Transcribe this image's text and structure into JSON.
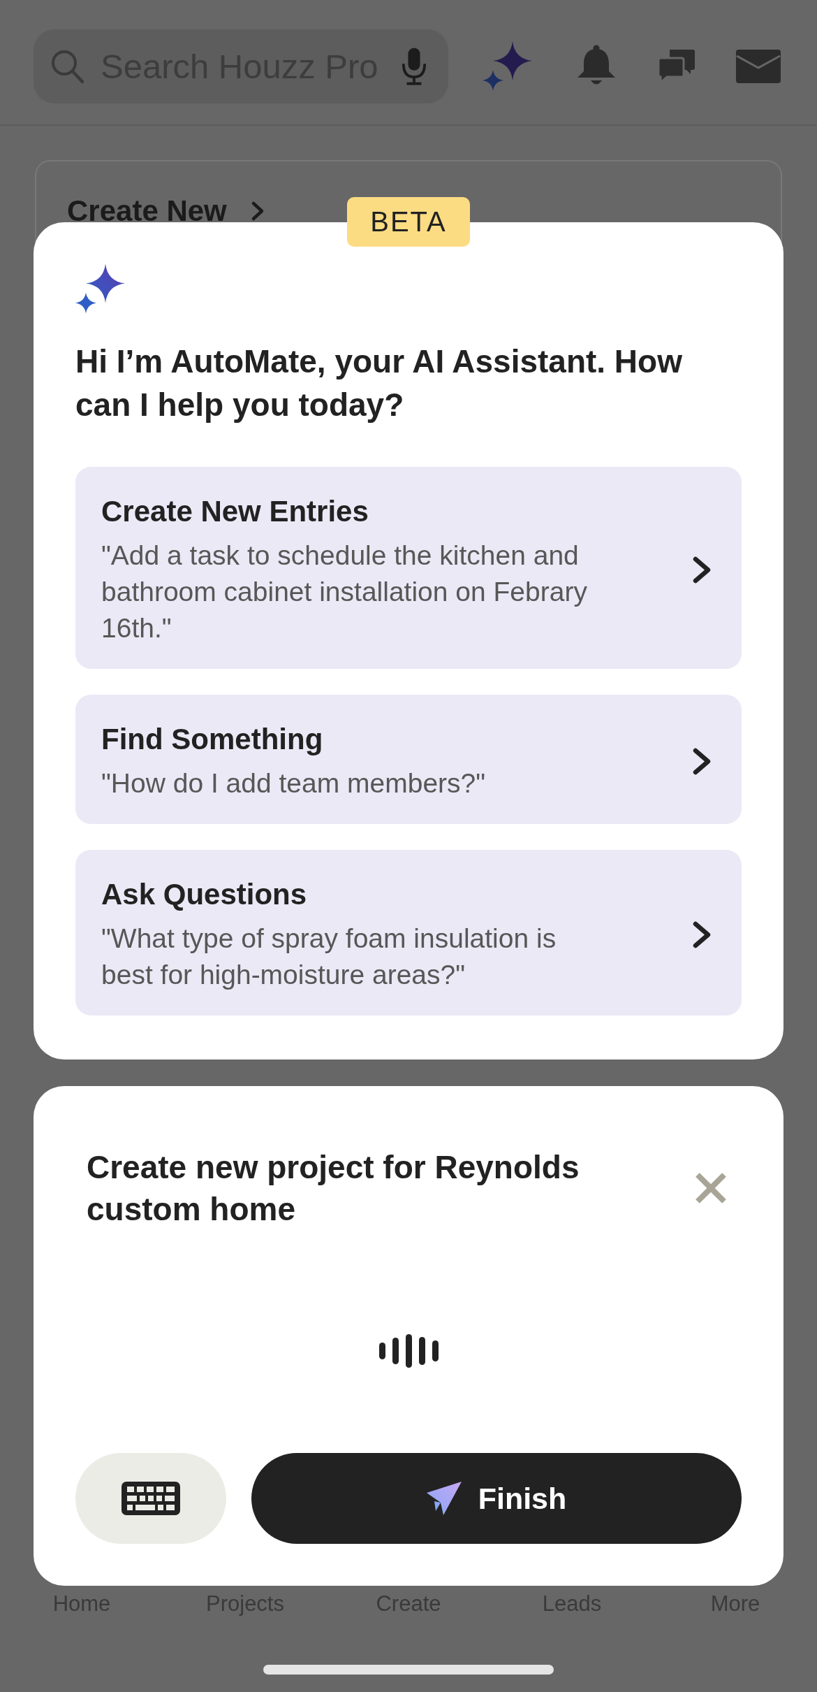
{
  "search": {
    "placeholder": "Search Houzz Pro"
  },
  "create_new_card": {
    "title": "Create New"
  },
  "assistant": {
    "badge": "BETA",
    "greeting": "Hi I’m AutoMate, your AI Assistant. How can I help you today?",
    "suggestions": [
      {
        "title": "Create New Entries",
        "example": "\"Add a task to schedule the kitchen and bathroom cabinet installation on Febrary 16th.\""
      },
      {
        "title": "Find Something",
        "example": "\"How do I add team members?\""
      },
      {
        "title": "Ask Questions",
        "example": "\"What type of spray foam insulation is best for high-moisture areas?\""
      }
    ]
  },
  "voice_sheet": {
    "transcript": "Create new project for Reynolds custom home",
    "finish_button": "Finish"
  },
  "tab_bar": [
    {
      "label": "Home"
    },
    {
      "label": "Projects"
    },
    {
      "label": "Create"
    },
    {
      "label": "Leads"
    },
    {
      "label": "More"
    }
  ]
}
